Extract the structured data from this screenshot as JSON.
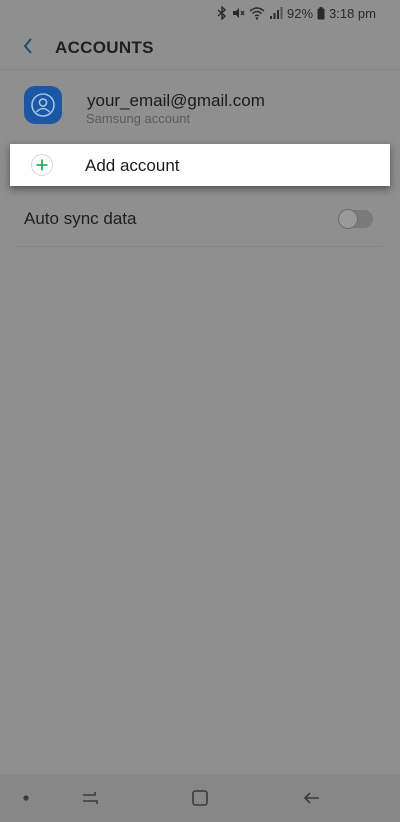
{
  "status_bar": {
    "battery_percent": "92%",
    "time": "3:18 pm",
    "icons": [
      "bluetooth-icon",
      "mute-icon",
      "wifi-icon",
      "signal-icon",
      "battery-icon"
    ]
  },
  "header": {
    "title": "ACCOUNTS",
    "back_icon": "chevron-left-icon"
  },
  "account": {
    "email": "your_email@gmail.com",
    "type": "Samsung account",
    "icon": "samsung-account-icon"
  },
  "add_account": {
    "label": "Add account",
    "icon": "plus-icon"
  },
  "auto_sync": {
    "label": "Auto sync data",
    "enabled": false
  },
  "nav_bar": {
    "icons": [
      "dot-icon",
      "recents-icon",
      "home-icon",
      "back-icon"
    ]
  },
  "colors": {
    "accent": "#00a94f",
    "account_icon_bg": "#1c57a4",
    "overlay_bg": "#8f8f8f"
  }
}
